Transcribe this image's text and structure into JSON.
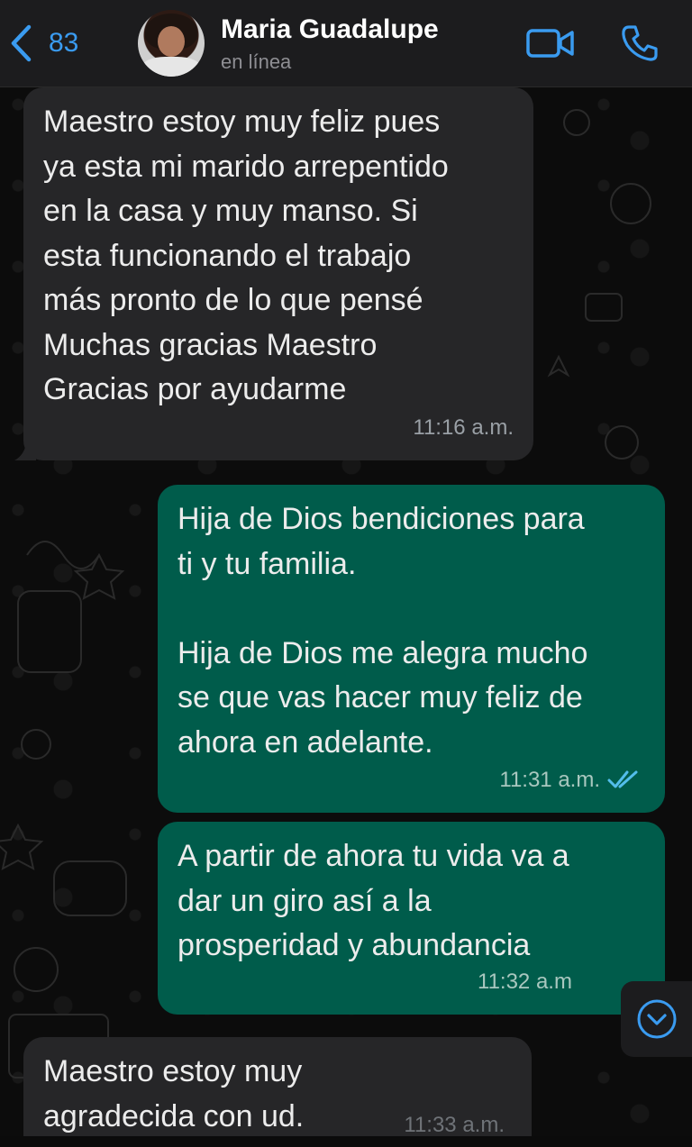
{
  "header": {
    "back_count": "83",
    "contact_name": "Maria Guadalupe",
    "status": "en línea"
  },
  "messages": [
    {
      "direction": "incoming",
      "text": "Maestro estoy muy feliz pues\nya esta mi marido arrepentido\nen la casa y muy manso. Si\nesta funcionando el trabajo\nmás pronto de lo que pensé\nMuchas gracias Maestro\nGracias por ayudarme",
      "time": "11:16 a.m."
    },
    {
      "direction": "outgoing",
      "text": "Hija de Dios bendiciones para\nti y tu familia.\n\nHija de Dios me alegra mucho\nse que vas hacer muy feliz de\nahora en adelante.",
      "time": "11:31 a.m.",
      "status": "read"
    },
    {
      "direction": "outgoing",
      "text": "A partir de ahora tu vida va a\ndar un giro así a la\nprosperidad y abundancia",
      "time": "11:32 a.m",
      "status": "read"
    },
    {
      "direction": "incoming",
      "text": "Maestro estoy muy\nagradecida con ud.",
      "time": "11:33 a.m."
    }
  ],
  "icons": {
    "back": "chevron-left-icon",
    "video": "video-camera-icon",
    "phone": "phone-icon",
    "read": "double-check-icon",
    "scroll": "chevron-down-circle-icon"
  },
  "colors": {
    "accent": "#3a9bf0",
    "incoming_bubble": "#262628",
    "outgoing_bubble": "#005c4b",
    "header": "#1c1c1e",
    "background": "#0b0b0b"
  }
}
